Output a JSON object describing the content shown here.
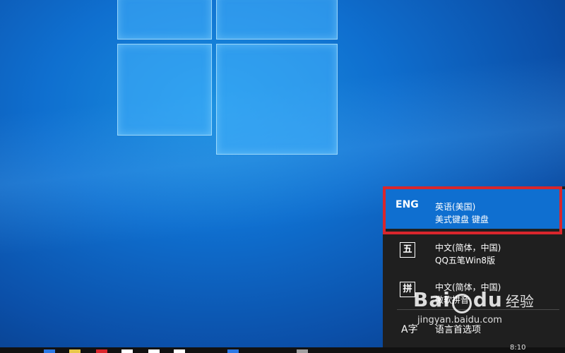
{
  "language_menu": {
    "items": [
      {
        "abbr": "ENG",
        "name": "英语(美国)",
        "keyboard": "美式键盘 键盘",
        "selected": true
      },
      {
        "abbr": "五",
        "name": "中文(简体，中国)",
        "keyboard": "QQ五笔Win8版",
        "selected": false
      },
      {
        "abbr": "拼",
        "name": "中文(简体，中国)",
        "keyboard": "微软拼音",
        "selected": false
      }
    ],
    "settings_icon": "A字",
    "settings_label": "语言首选项"
  },
  "taskbar": {
    "clock": "8:10",
    "icon_colors": [
      "#2b78e4",
      "#e8c84a",
      "#d9262c",
      "#ffffff",
      "#ffffff",
      "#ffffff",
      "#2b78e4",
      "#9e9e9e"
    ]
  },
  "watermark": {
    "brand_left": "Bai",
    "brand_right": "du",
    "tail": "经验",
    "url": "jingyan.baidu.com"
  },
  "colors": {
    "selected_bg": "#0f6fd0",
    "flyout_bg": "#1f1f1f",
    "highlight_border": "#d9262c"
  }
}
